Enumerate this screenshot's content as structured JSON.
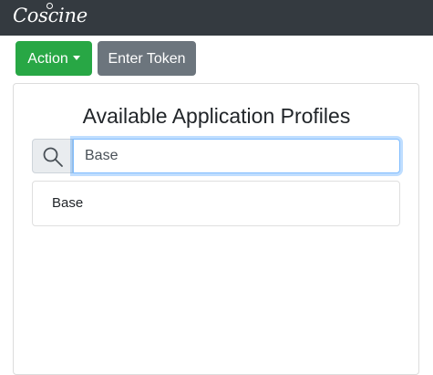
{
  "header": {
    "logo_text": "Coscine",
    "background_color": "#343a40"
  },
  "toolbar": {
    "action_label": "Action",
    "action_color": "#28a745",
    "token_label": "Enter Token",
    "token_color": "#6c757d"
  },
  "main": {
    "title": "Available Application Profiles",
    "search": {
      "icon": "search-icon",
      "value": "Base"
    },
    "results": [
      {
        "label": "Base"
      }
    ]
  }
}
